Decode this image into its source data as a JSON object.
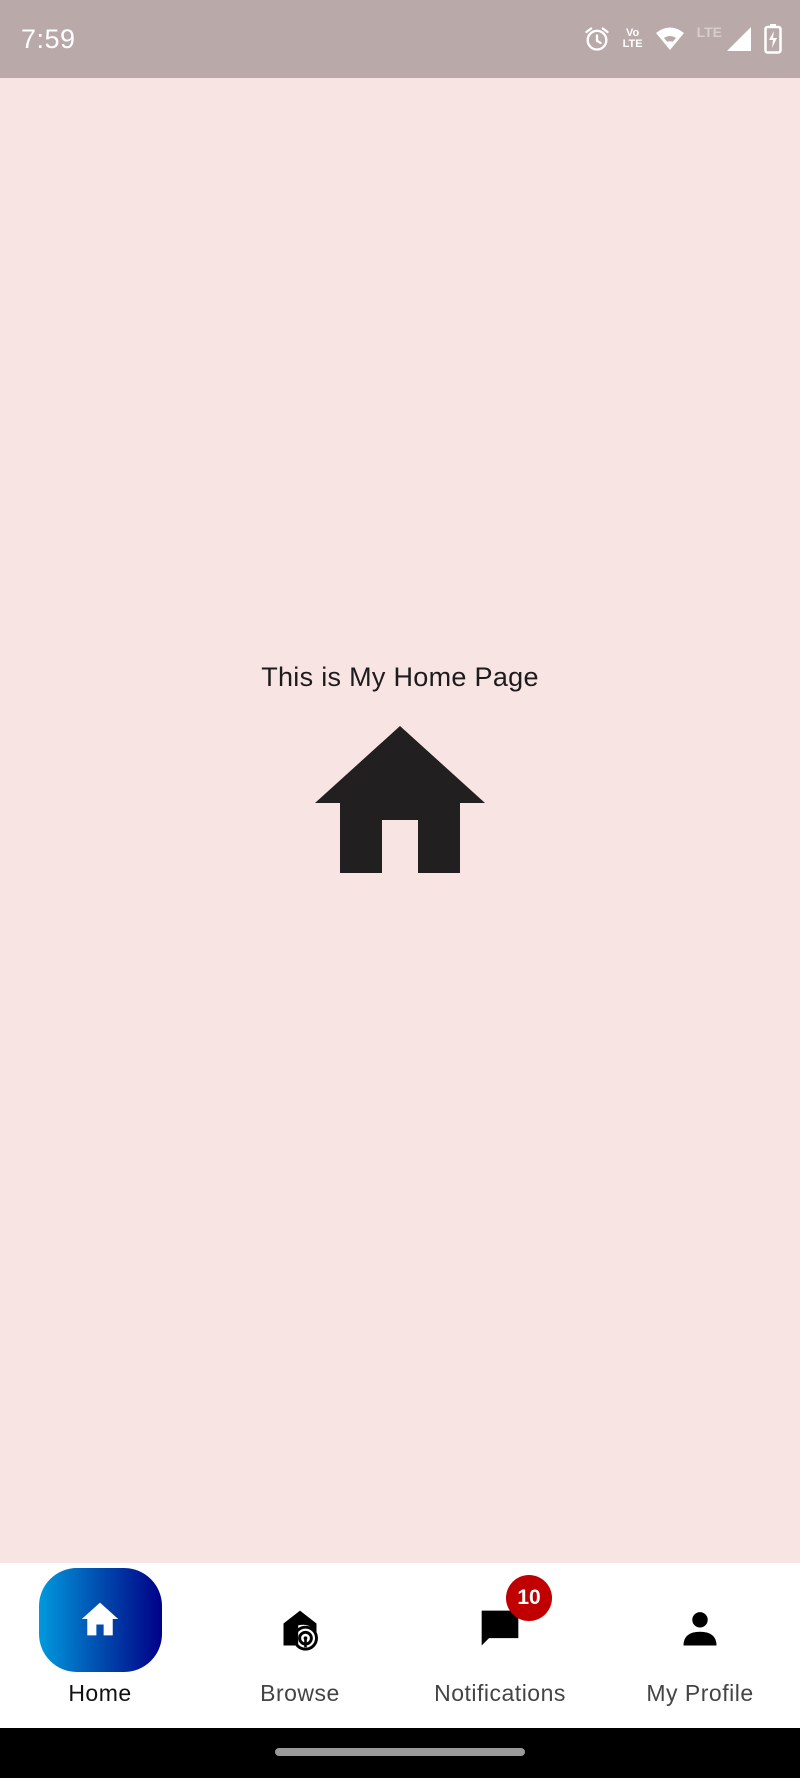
{
  "status_bar": {
    "time": "7:59",
    "volte_top": "Vo",
    "volte_bottom": "LTE",
    "lte_label": "LTE",
    "icons": [
      "alarm-icon",
      "volte-icon",
      "wifi-icon",
      "signal-icon",
      "battery-icon"
    ]
  },
  "main": {
    "title": "This is My Home Page",
    "icon": "home-icon"
  },
  "bottom_nav": {
    "items": [
      {
        "label": "Home",
        "icon": "home-icon",
        "active": true
      },
      {
        "label": "Browse",
        "icon": "browse-icon",
        "active": false
      },
      {
        "label": "Notifications",
        "icon": "chat-icon",
        "active": false,
        "badge": "10"
      },
      {
        "label": "My Profile",
        "icon": "person-icon",
        "active": false
      }
    ]
  },
  "colors": {
    "background": "#F7E4E3",
    "status_bar": "#BAA9A9",
    "active_gradient_start": "#0099DD",
    "active_gradient_end": "#000088",
    "badge": "#C00000"
  }
}
